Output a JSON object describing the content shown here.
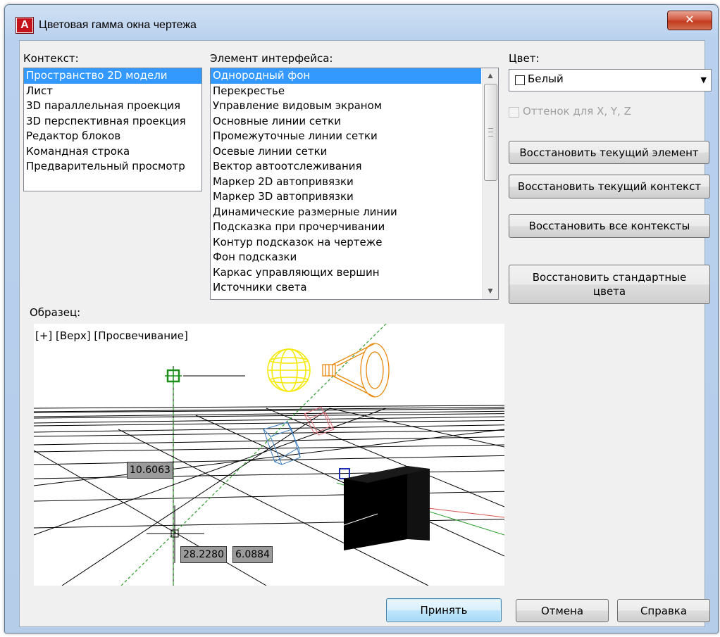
{
  "window": {
    "title": "Цветовая гамма окна чертежа",
    "app_icon_letter": "A",
    "close_glyph": "✕"
  },
  "context": {
    "label": "Контекст:",
    "items": [
      "Пространство 2D модели",
      "Лист",
      "3D параллельная проекция",
      "3D перспективная проекция",
      "Редактор блоков",
      "Командная строка",
      "Предварительный просмотр"
    ],
    "selected": 0
  },
  "interface_element": {
    "label": "Элемент интерфейса:",
    "items": [
      "Однородный фон",
      "Перекрестье",
      "Управление видовым экраном",
      "Основные линии сетки",
      "Промежуточные линии сетки",
      "Осевые линии сетки",
      "Вектор автоотслеживания",
      "Маркер 2D автопривязки",
      "Маркер 3D автопривязки",
      "Динамические размерные линии",
      "Подсказка при прочерчивании",
      "Контур подсказок на чертеже",
      "Фон подсказки",
      "Каркас управляющих вершин",
      "Источники света"
    ],
    "selected": 0
  },
  "color": {
    "label": "Цвет:",
    "value": "Белый",
    "swatch": "#ffffff",
    "tint_label": "Оттенок для X, Y, Z"
  },
  "buttons": {
    "restore_element": "Восстановить текущий элемент",
    "restore_context": "Восстановить текущий контекст",
    "restore_all": "Восстановить все контексты",
    "restore_standard": "Восстановить стандартные цвета",
    "accept": "Принять",
    "cancel": "Отмена",
    "help": "Справка"
  },
  "preview": {
    "label": "Образец:",
    "viewport_label": "[+] [Верх] [Просвечивание]",
    "dim1": "10.6063",
    "dim2": "28.2280",
    "dim3": "6.0884"
  },
  "colors": {
    "selection": "#3399ff",
    "light_bulb": "#f5e90a",
    "spotlight": "#e8890c",
    "axis_x": "#d9534f",
    "axis_y": "#2a9d2a",
    "snap_marker_2d": "#1a8f1a",
    "snap_marker_3d": "#1f2fb3",
    "camera": "#3d7dbf"
  }
}
